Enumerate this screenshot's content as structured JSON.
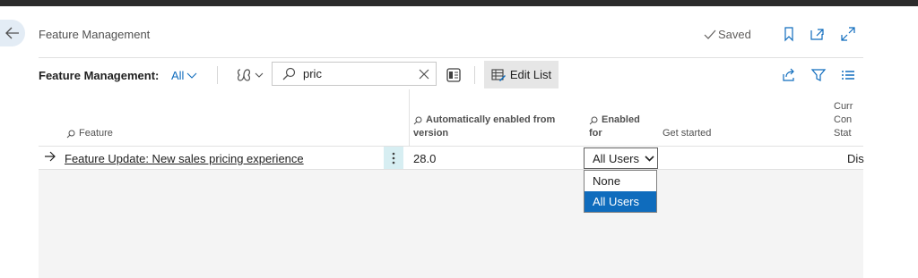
{
  "header": {
    "title": "Feature Management",
    "saved_label": "Saved",
    "back_icon": "arrow-left-icon",
    "icons": [
      "bookmark-icon",
      "open-new-window-icon",
      "expand-icon"
    ]
  },
  "actionbar": {
    "title": "Feature Management:",
    "view_label": "All",
    "search_value": "pric",
    "edit_list_label": "Edit List"
  },
  "columns": {
    "feature": "Feature",
    "auto_enabled_line1": "Automatically enabled from",
    "auto_enabled_line2": "version",
    "enabled_line1": "Enabled",
    "enabled_line2": "for",
    "get_started": "Get started",
    "status_line1": "Curr",
    "status_line2": "Con",
    "status_line3": "Stat"
  },
  "rows": [
    {
      "feature": "Feature Update: New sales pricing experience",
      "version": "28.0",
      "enabled_for": "All Users",
      "status": "Dis"
    }
  ],
  "dropdown": {
    "options": [
      "None",
      "All Users"
    ],
    "selected": "All Users"
  },
  "colors": {
    "accent": "#0f6cbd",
    "row_menu_bg": "#d7eef2",
    "back_button_bg": "#e3ecf5"
  }
}
